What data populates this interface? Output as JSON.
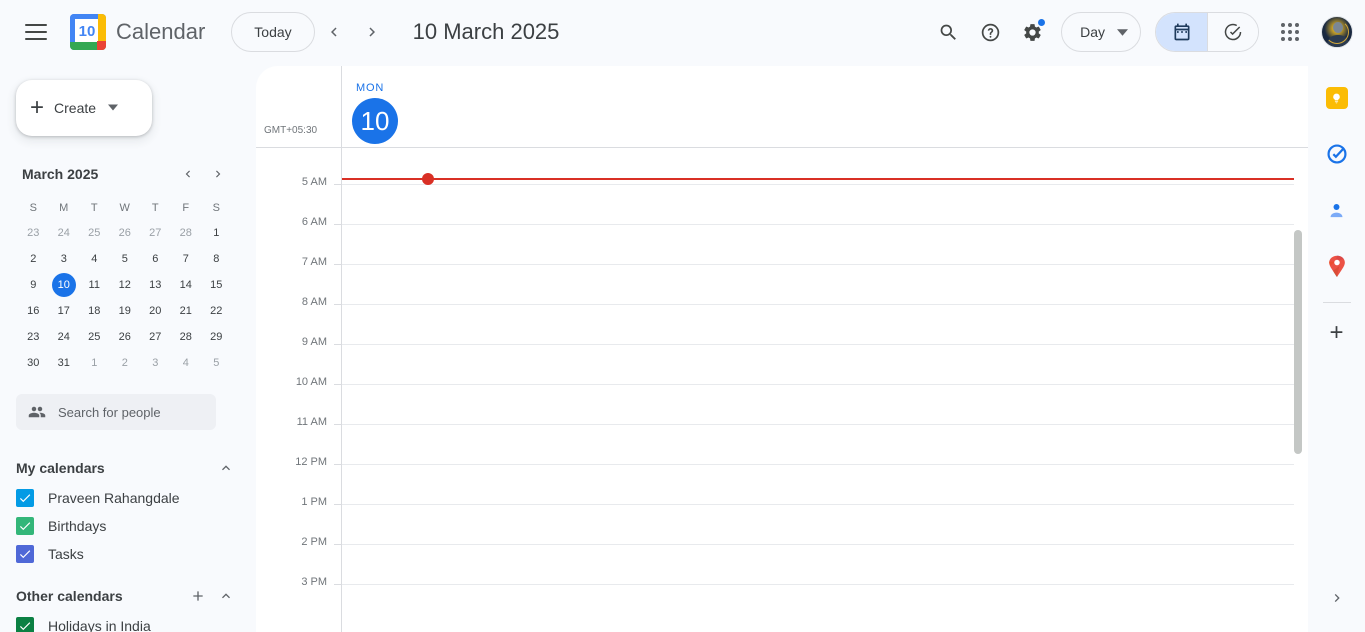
{
  "app": {
    "brand_title": "Calendar",
    "logo_day": "10"
  },
  "topbar": {
    "menu_icon": "hamburger-icon",
    "today_label": "Today",
    "prev_icon": "chevron-left-icon",
    "next_icon": "chevron-right-icon",
    "date_title": "10 March 2025",
    "search_icon": "search-icon",
    "help_icon": "help-icon",
    "settings_icon": "gear-icon",
    "view_label": "Day",
    "view_caret": "▾",
    "toggle_calendar_icon": "calendar-icon",
    "toggle_tasks_icon": "check-circle-icon",
    "apps_icon": "apps-grid-icon",
    "avatar_icon": "user-avatar"
  },
  "sidebar": {
    "create_label": "Create",
    "create_plus": "+",
    "create_caret": "▾",
    "mini_calendar": {
      "month_label": "March 2025",
      "prev_icon": "chevron-left-icon",
      "next_icon": "chevron-right-icon",
      "weekday_initials": [
        "S",
        "M",
        "T",
        "W",
        "T",
        "F",
        "S"
      ],
      "weeks": [
        [
          {
            "d": "23",
            "muted": true
          },
          {
            "d": "24",
            "muted": true
          },
          {
            "d": "25",
            "muted": true
          },
          {
            "d": "26",
            "muted": true
          },
          {
            "d": "27",
            "muted": true
          },
          {
            "d": "28",
            "muted": true
          },
          {
            "d": "1",
            "muted": false
          }
        ],
        [
          {
            "d": "2"
          },
          {
            "d": "3"
          },
          {
            "d": "4"
          },
          {
            "d": "5"
          },
          {
            "d": "6"
          },
          {
            "d": "7"
          },
          {
            "d": "8"
          }
        ],
        [
          {
            "d": "9"
          },
          {
            "d": "10",
            "selected": true
          },
          {
            "d": "11"
          },
          {
            "d": "12"
          },
          {
            "d": "13"
          },
          {
            "d": "14"
          },
          {
            "d": "15"
          }
        ],
        [
          {
            "d": "16"
          },
          {
            "d": "17"
          },
          {
            "d": "18"
          },
          {
            "d": "19"
          },
          {
            "d": "20"
          },
          {
            "d": "21"
          },
          {
            "d": "22"
          }
        ],
        [
          {
            "d": "23"
          },
          {
            "d": "24"
          },
          {
            "d": "25"
          },
          {
            "d": "26"
          },
          {
            "d": "27"
          },
          {
            "d": "28"
          },
          {
            "d": "29"
          }
        ],
        [
          {
            "d": "30"
          },
          {
            "d": "31"
          },
          {
            "d": "1",
            "muted": true
          },
          {
            "d": "2",
            "muted": true
          },
          {
            "d": "3",
            "muted": true
          },
          {
            "d": "4",
            "muted": true
          },
          {
            "d": "5",
            "muted": true
          }
        ]
      ]
    },
    "people_search": {
      "icon": "people-icon",
      "placeholder": "Search for people"
    },
    "my_calendars": {
      "title": "My calendars",
      "collapse_icon": "chevron-up-icon",
      "items": [
        {
          "label": "Praveen Rahangdale",
          "color": "#039be5",
          "checked": true
        },
        {
          "label": "Birthdays",
          "color": "#33b679",
          "checked": true
        },
        {
          "label": "Tasks",
          "color": "#4f68d7",
          "checked": true
        }
      ]
    },
    "other_calendars": {
      "title": "Other calendars",
      "add_icon": "plus-icon",
      "collapse_icon": "chevron-up-icon",
      "items": [
        {
          "label": "Holidays in India",
          "color": "#0b8043",
          "checked": true
        }
      ]
    }
  },
  "main": {
    "timezone_label": "GMT+05:30",
    "day_of_week": "MON",
    "day_number": "10",
    "hours": [
      "5 AM",
      "6 AM",
      "7 AM",
      "8 AM",
      "9 AM",
      "10 AM",
      "11 AM",
      "12 PM",
      "1 PM",
      "2 PM",
      "3 PM"
    ],
    "current_time_color": "#d93025",
    "events": []
  },
  "rail": {
    "items": [
      {
        "name": "google-keep-icon",
        "label": "Keep"
      },
      {
        "name": "google-tasks-icon",
        "label": "Tasks"
      },
      {
        "name": "google-contacts-icon",
        "label": "Contacts"
      },
      {
        "name": "google-maps-icon",
        "label": "Maps"
      }
    ],
    "add_label": "+",
    "expand_icon": "chevron-right-icon"
  },
  "colors": {
    "accent_blue": "#1a73e8",
    "surface": "#f8fafd",
    "canvas": "#ffffff",
    "today_red": "#d93025"
  }
}
